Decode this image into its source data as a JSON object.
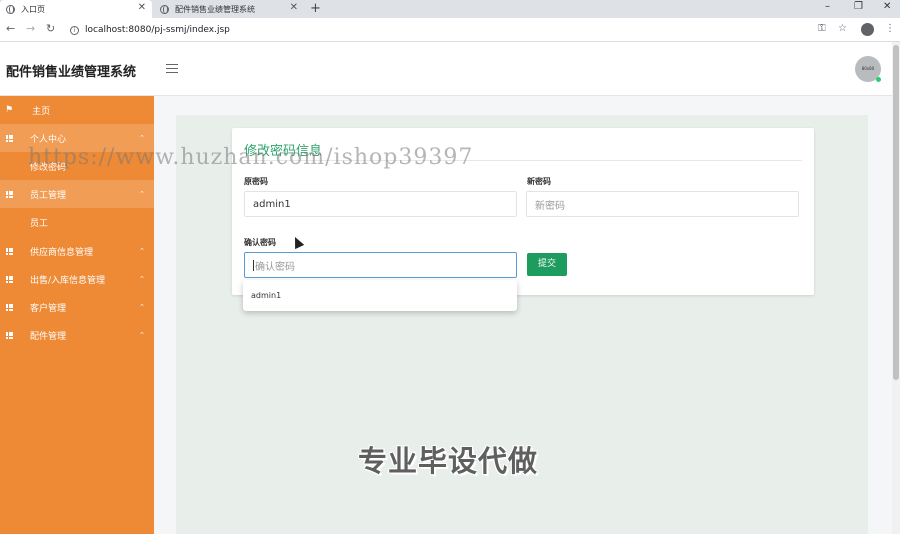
{
  "browser": {
    "tabs": [
      {
        "title": "入口页",
        "active": true
      },
      {
        "title": "配件销售业绩管理系统",
        "active": false
      }
    ],
    "url": "localhost:8080/pj-ssmj/index.jsp",
    "window_controls": [
      "–",
      "❐",
      "✕"
    ]
  },
  "header": {
    "title": "配件销售业绩管理系统",
    "avatar_text": "80x80"
  },
  "sidebar": {
    "items": [
      {
        "label": "主页",
        "icon": "flag-icon"
      },
      {
        "label": "个人中心",
        "icon": "grid-icon",
        "expanded": true
      },
      {
        "label": "修改密码",
        "sub": true
      },
      {
        "label": "员工管理",
        "icon": "grid-icon",
        "expanded": true
      },
      {
        "label": "员工",
        "sub": true
      },
      {
        "label": "供应商信息管理",
        "icon": "grid-icon"
      },
      {
        "label": "出售/入库信息管理",
        "icon": "grid-icon"
      },
      {
        "label": "客户管理",
        "icon": "grid-icon"
      },
      {
        "label": "配件管理",
        "icon": "grid-icon"
      }
    ],
    "caret": "⌃",
    "accent_color": "#ee8a36"
  },
  "form": {
    "title": "修改密码信息",
    "old_password_label": "原密码",
    "old_password_value": "admin1",
    "new_password_label": "新密码",
    "new_password_placeholder": "新密码",
    "confirm_password_label": "确认密码",
    "confirm_password_placeholder": "确认密码",
    "submit_label": "提交",
    "autocomplete_suggestion": "admin1",
    "button_color": "#1e9b5f"
  },
  "watermarks": {
    "url_text": "https://www.huzhan.com/ishop39397",
    "promo_text": "专业毕设代做"
  }
}
